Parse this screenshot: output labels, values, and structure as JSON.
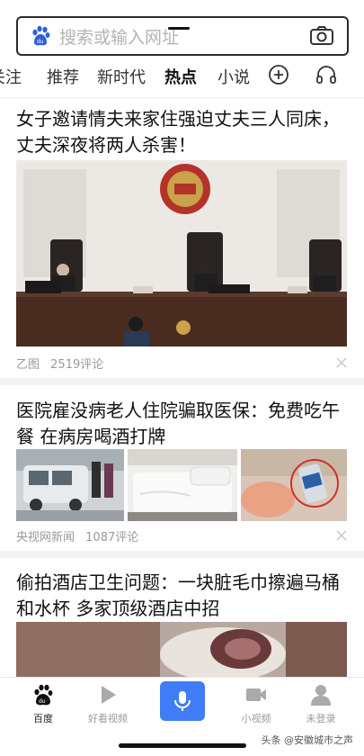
{
  "search": {
    "placeholder": "搜索或输入网址",
    "logo_icon": "baidu-paw-icon",
    "camera_icon": "camera-icon"
  },
  "tabs": [
    {
      "label": "关注",
      "active": false
    },
    {
      "label": "推荐",
      "active": false
    },
    {
      "label": "新时代",
      "active": false
    },
    {
      "label": "热点",
      "active": true
    },
    {
      "label": "小说",
      "active": false
    }
  ],
  "tab_icons": [
    "add-channel-icon",
    "headphones-icon"
  ],
  "articles": [
    {
      "title": "女子邀请情夫来家住强迫丈夫三人同床，丈夫深夜将两人杀害！",
      "source": "乙图",
      "comments": "2519评论"
    },
    {
      "title": "医院雇没病老人住院骗取医保：免费吃午餐 在病房喝酒打牌",
      "source": "央视网新闻",
      "comments": "1087评论"
    },
    {
      "title": "偷拍酒店卫生问题：一块脏毛巾擦遍马桶和水杯 多家顶级酒店中招",
      "source": "",
      "comments": ""
    }
  ],
  "bottom_nav": [
    {
      "label": "百度",
      "icon": "baidu-paw-icon",
      "active": true
    },
    {
      "label": "好看视频",
      "icon": "play-icon",
      "active": false
    },
    {
      "label": "",
      "icon": "microphone-icon",
      "active": false
    },
    {
      "label": "小视频",
      "icon": "video-camera-icon",
      "active": false
    },
    {
      "label": "未登录",
      "icon": "user-icon",
      "active": false
    }
  ],
  "watermark": "头条 @安徽城市之声",
  "colors": {
    "accent_blue": "#3f7cf5",
    "text": "#111111",
    "meta": "#999999"
  }
}
